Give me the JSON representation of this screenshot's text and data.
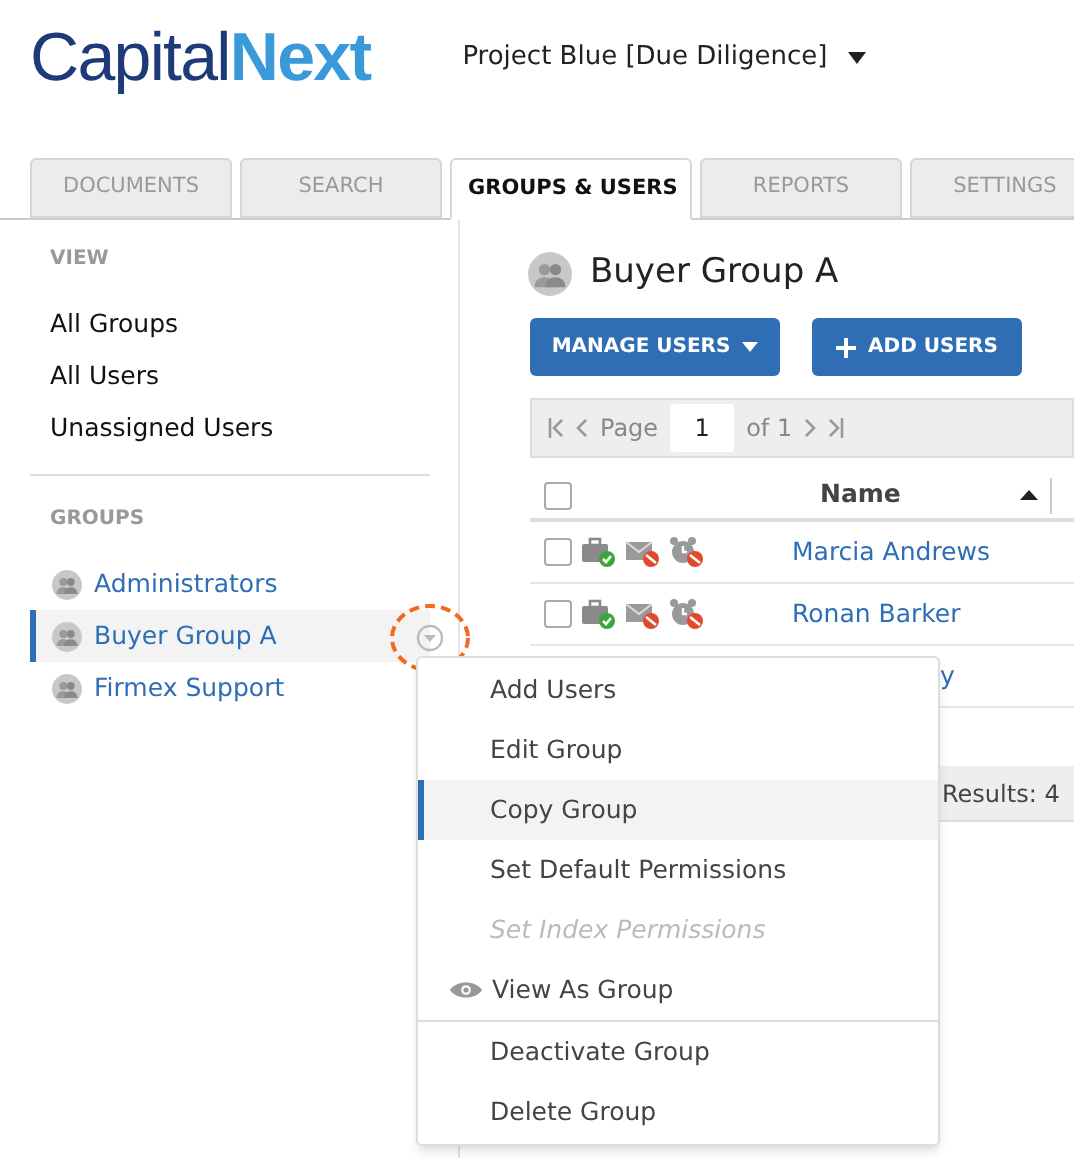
{
  "logo": {
    "part_1": "Capital",
    "part_2": "Next"
  },
  "project": {
    "title": "Project Blue [Due Diligence]"
  },
  "tabs": [
    {
      "label": "DOCUMENTS",
      "selected": false
    },
    {
      "label": "SEARCH",
      "selected": false
    },
    {
      "label": "GROUPS & USERS",
      "selected": true
    },
    {
      "label": "REPORTS",
      "selected": false
    },
    {
      "label": "SETTINGS",
      "selected": false
    }
  ],
  "sidebar": {
    "view_heading": "VIEW",
    "view_items": [
      "All Groups",
      "All Users",
      "Unassigned Users"
    ],
    "groups_heading": "GROUPS",
    "groups": [
      {
        "name": "Administrators",
        "selected": false
      },
      {
        "name": "Buyer Group A",
        "selected": true
      },
      {
        "name": "Firmex Support",
        "selected": false
      }
    ]
  },
  "group": {
    "title": "Buyer Group A",
    "manage_button": "MANAGE USERS",
    "add_button": "ADD USERS"
  },
  "pager": {
    "page_label": "Page",
    "page": "1",
    "of_label": "of 1"
  },
  "table": {
    "columns": [
      "Name"
    ],
    "all_checked": false,
    "rows": [
      {
        "name": "Marcia Andrews",
        "checked": false
      },
      {
        "name": "Ronan Barker",
        "checked": false
      }
    ],
    "partial_row_name": "y",
    "results": "Results: 4"
  },
  "menu": {
    "items": [
      {
        "label": "Add Users",
        "kind": "item",
        "selected": false,
        "disabled": false
      },
      {
        "label": "Edit Group",
        "kind": "item",
        "selected": false,
        "disabled": false
      },
      {
        "label": "Copy Group",
        "kind": "item",
        "selected": true,
        "disabled": false
      },
      {
        "label": "Set Default Permissions",
        "kind": "item",
        "selected": false,
        "disabled": false
      },
      {
        "label": "Set Index Permissions",
        "kind": "item",
        "selected": false,
        "disabled": true
      },
      {
        "label": "View As Group",
        "kind": "eye",
        "selected": false,
        "disabled": false
      },
      {
        "label": "Deactivate Group",
        "kind": "divided",
        "selected": false,
        "disabled": false
      },
      {
        "label": "Delete Group",
        "kind": "item",
        "selected": false,
        "disabled": false
      }
    ]
  }
}
